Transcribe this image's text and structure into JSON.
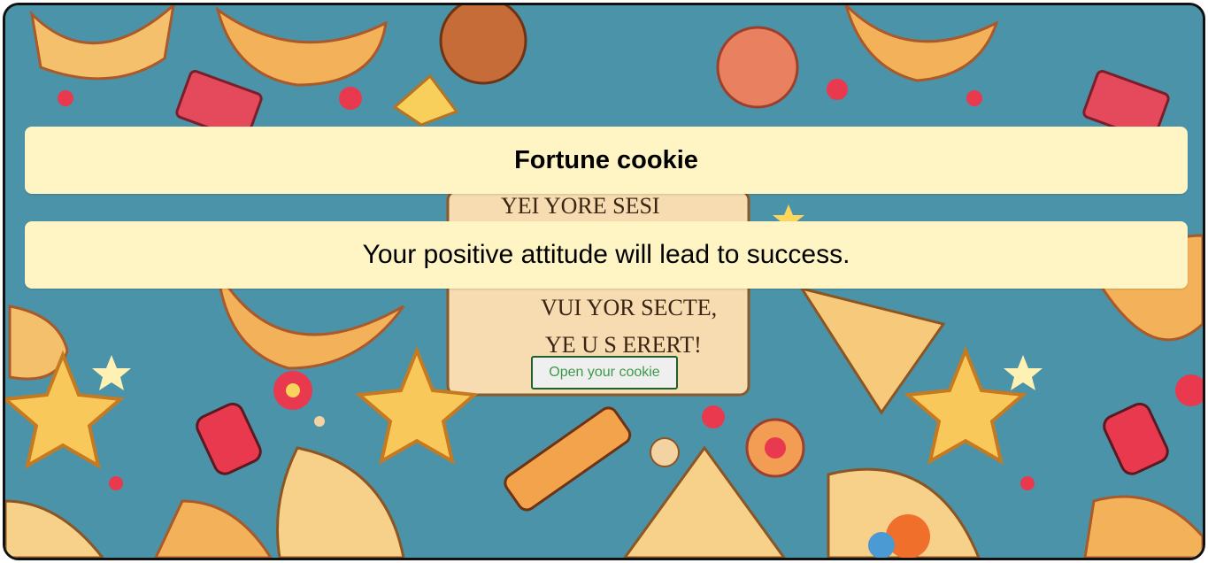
{
  "app": {
    "title": "Fortune cookie",
    "fortune": "Your positive attitude will lead to success.",
    "open_button_label": "Open your cookie"
  },
  "background": {
    "image": "fortune-cookie-pattern",
    "scroll_text": [
      "YEI YORE SESI",
      "VUI YOR SECTE,",
      "YE U S ERERT!"
    ]
  },
  "colors": {
    "backdrop": "#4b93a9",
    "panel": "#fff5c4",
    "button_text": "#3c9a48",
    "button_border": "#1f5f2a",
    "button_bg": "#efefef"
  }
}
